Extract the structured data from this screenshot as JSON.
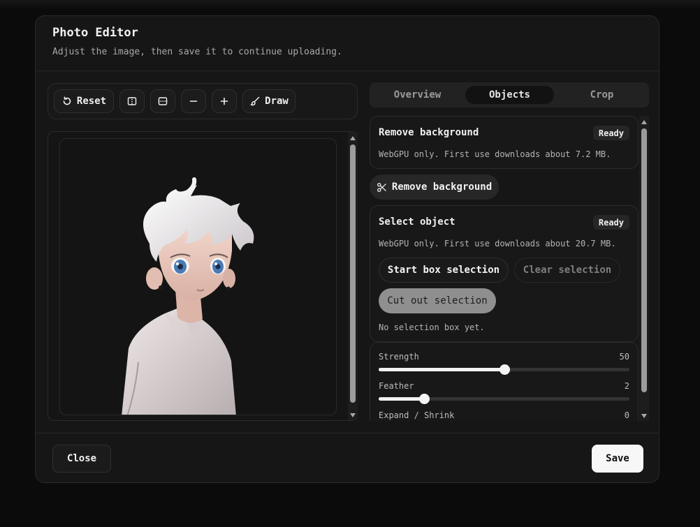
{
  "dialog": {
    "title": "Photo Editor",
    "subtitle": "Adjust the image, then save it to continue uploading."
  },
  "toolbar": {
    "reset_label": "Reset",
    "draw_label": "Draw",
    "icons": [
      "reset-icon",
      "flip-horizontal-icon",
      "flip-vertical-icon",
      "zoom-out-icon",
      "zoom-in-icon",
      "brush-icon"
    ]
  },
  "tabs": [
    {
      "label": "Overview",
      "active": false
    },
    {
      "label": "Objects",
      "active": true
    },
    {
      "label": "Crop",
      "active": false
    }
  ],
  "remove_background": {
    "title": "Remove background",
    "status": "Ready",
    "description": "WebGPU only. First use downloads about 7.2 MB.",
    "button_label": "Remove background"
  },
  "select_object": {
    "title": "Select object",
    "status": "Ready",
    "description": "WebGPU only. First use downloads about 20.7 MB.",
    "start_label": "Start box selection",
    "clear_label": "Clear selection",
    "cutout_label": "Cut out selection",
    "status_text": "No selection box yet."
  },
  "sliders": [
    {
      "label": "Strength",
      "value": "50",
      "fraction": 0.5
    },
    {
      "label": "Feather",
      "value": "2",
      "fraction": 0.18
    },
    {
      "label": "Expand / Shrink",
      "value": "0"
    }
  ],
  "footer": {
    "close_label": "Close",
    "save_label": "Save"
  },
  "colors": {
    "accent": "#f7f7f7",
    "surface": "#161616"
  }
}
